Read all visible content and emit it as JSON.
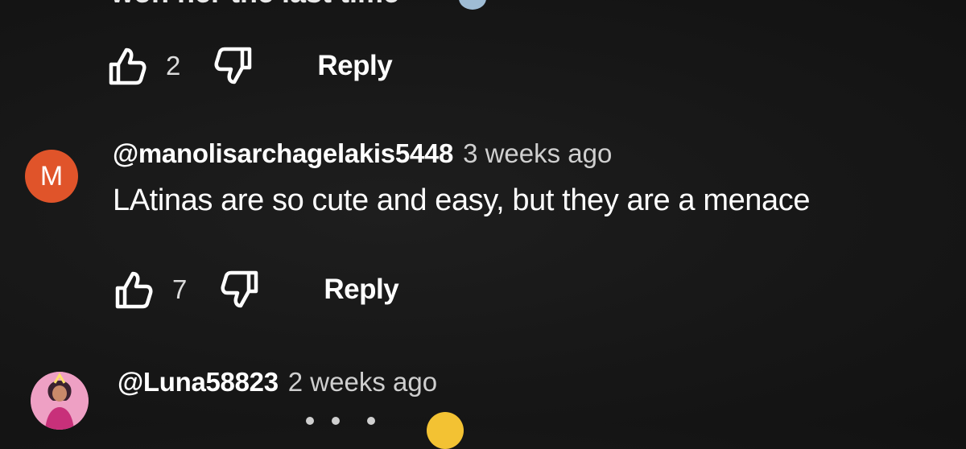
{
  "prev_comment": {
    "text_cut": "won her the last time",
    "likes": "2",
    "reply_label": "Reply"
  },
  "comments": [
    {
      "avatar_letter": "M",
      "avatar_color": "#e0542a",
      "author": "@manolisarchagelakis5448",
      "time": "3 weeks ago",
      "text": "LAtinas are so cute and easy, but they are a menace",
      "likes": "7",
      "reply_label": "Reply"
    },
    {
      "avatar_desc": "pink image avatar",
      "author": "@Luna58823",
      "time": "2 weeks ago"
    }
  ],
  "icons": [
    "thumbs-up-icon",
    "thumbs-down-icon"
  ]
}
